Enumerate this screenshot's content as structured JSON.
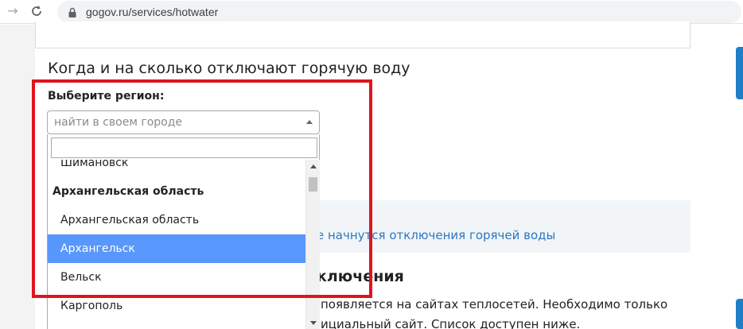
{
  "browser": {
    "url": "gogov.ru/services/hotwater"
  },
  "page": {
    "section_title": "Когда и на сколько отключают горячую воду",
    "region_label": "Выберите регион:",
    "select_placeholder": "найти в своем городе",
    "dropdown_items": [
      {
        "label": "Шимановск",
        "type": "option"
      },
      {
        "label": "Архангельская область",
        "type": "group"
      },
      {
        "label": "Архангельская область",
        "type": "option"
      },
      {
        "label": "Архангельск",
        "type": "option",
        "selected": true
      },
      {
        "label": "Вельск",
        "type": "option"
      },
      {
        "label": "Каргополь",
        "type": "option"
      }
    ],
    "info_link": "е начнутся отключения горячей воды",
    "heading_partial": "ключения",
    "paragraph_line1": "появляется на сайтах теплосетей. Необходимо только",
    "paragraph_line2": "ициальный сайт. Список доступен ниже."
  },
  "colors": {
    "highlight": "#e0141e",
    "selected_option": "#5897fb",
    "link": "#2a77c2",
    "accent_tab": "#1f7fc7"
  }
}
